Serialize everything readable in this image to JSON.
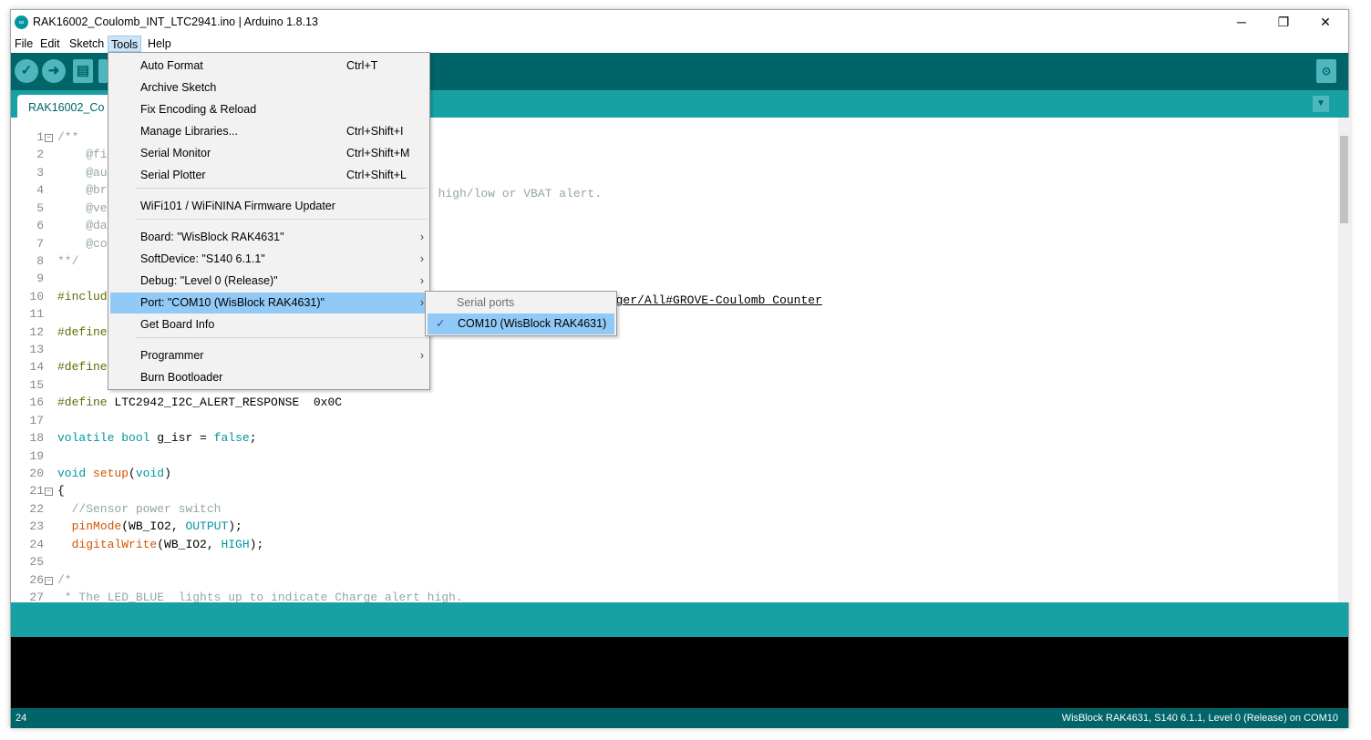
{
  "title": "RAK16002_Coulomb_INT_LTC2941.ino | Arduino 1.8.13",
  "window_controls": {
    "minimize": "─",
    "maximize": "❐",
    "close": "✕"
  },
  "menubar": [
    "File",
    "Edit",
    "Sketch",
    "Tools",
    "Help"
  ],
  "tab_label": "RAK16002_Co",
  "code_lines": [
    [
      [
        "/**",
        "c"
      ]
    ],
    [
      [
        "    @fi",
        "c"
      ]
    ],
    [
      [
        "    @aut",
        "c"
      ]
    ],
    [
      [
        "    @bri",
        "c"
      ]
    ],
    [
      [
        "    @ver",
        "c"
      ]
    ],
    [
      [
        "    @dat",
        "c"
      ]
    ],
    [
      [
        "    @cop",
        "c"
      ]
    ],
    [
      [
        "**/",
        "c"
      ]
    ],
    [],
    [
      [
        "#includ",
        "pp"
      ]
    ],
    [],
    [
      [
        "#define",
        "pp"
      ]
    ],
    [],
    [
      [
        "#define",
        "pp"
      ]
    ],
    [],
    [
      [
        "#define",
        "pp"
      ],
      [
        " LTC2942_I2C_ALERT_RESPONSE  0x0C",
        ""
      ]
    ],
    [],
    [
      [
        "volatile",
        "kw"
      ],
      [
        " ",
        ""
      ],
      [
        "bool",
        "kw"
      ],
      [
        " g_isr = ",
        ""
      ],
      [
        "false",
        "kw"
      ],
      [
        ";",
        ""
      ]
    ],
    [],
    [
      [
        "void",
        "kw"
      ],
      [
        " ",
        ""
      ],
      [
        "setup",
        "fn"
      ],
      [
        "(",
        ""
      ],
      [
        "void",
        "kw"
      ],
      [
        ")",
        ""
      ]
    ],
    [
      [
        "{",
        ""
      ]
    ],
    [
      [
        "  //Sensor power switch",
        "c"
      ]
    ],
    [
      [
        "  ",
        ""
      ],
      [
        "pinMode",
        "fn"
      ],
      [
        "(WB_IO2, ",
        ""
      ],
      [
        "OUTPUT",
        "kw"
      ],
      [
        ");",
        ""
      ]
    ],
    [
      [
        "  ",
        ""
      ],
      [
        "digitalWrite",
        "fn"
      ],
      [
        "(WB_IO2, ",
        ""
      ],
      [
        "HIGH",
        "kw"
      ],
      [
        ");",
        ""
      ]
    ],
    [],
    [
      [
        "/*",
        "c"
      ]
    ],
    [
      [
        " * The LED_BLUE  lights up to indicate Charge alert high.",
        "c"
      ]
    ]
  ],
  "code_fragments": {
    "line4_tail": "t high/low or VBAT alert.",
    "line10_tail": "ibrary: https://librarymanager/All#GROVE-Coulomb_Counter"
  },
  "tools_menu": [
    {
      "label": "Auto Format",
      "shortcut": "Ctrl+T"
    },
    {
      "label": "Archive Sketch"
    },
    {
      "label": "Fix Encoding & Reload"
    },
    {
      "label": "Manage Libraries...",
      "shortcut": "Ctrl+Shift+I"
    },
    {
      "label": "Serial Monitor",
      "shortcut": "Ctrl+Shift+M"
    },
    {
      "label": "Serial Plotter",
      "shortcut": "Ctrl+Shift+L"
    },
    {
      "label": "WiFi101 / WiFiNINA Firmware Updater"
    },
    {
      "label": "Board: \"WisBlock RAK4631\"",
      "submenu": true
    },
    {
      "label": "SoftDevice: \"S140  6.1.1\"",
      "submenu": true
    },
    {
      "label": "Debug: \"Level 0 (Release)\"",
      "submenu": true
    },
    {
      "label": "Port: \"COM10 (WisBlock RAK4631)\"",
      "submenu": true,
      "highlighted": true
    },
    {
      "label": "Get Board Info"
    },
    {
      "label": "Programmer",
      "submenu": true
    },
    {
      "label": "Burn Bootloader"
    }
  ],
  "port_submenu": {
    "header": "Serial ports",
    "item": "COM10 (WisBlock RAK4631)",
    "checked": true
  },
  "bottom": {
    "line": "24",
    "board_info": "WisBlock RAK4631, S140  6.1.1, Level 0 (Release) on COM10"
  }
}
